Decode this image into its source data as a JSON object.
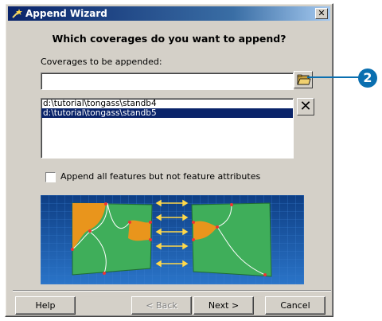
{
  "window": {
    "title": "Append Wizard",
    "close_glyph": "✕"
  },
  "question": "Which coverages do you want to append?",
  "coverages_label": "Coverages to be appended:",
  "coverage_input": {
    "value": ""
  },
  "browse_icon": "open-folder-icon",
  "delete_glyph": "✕",
  "list_items": [
    {
      "text": "d:\\tutorial\\tongass\\standb4",
      "selected": false
    },
    {
      "text": "d:\\tutorial\\tongass\\standb5",
      "selected": true
    }
  ],
  "append_checkbox": {
    "label": "Append all features but not feature attributes",
    "checked": false
  },
  "buttons": {
    "help": "Help",
    "back": "< Back",
    "next": "Next >",
    "cancel": "Cancel"
  },
  "callout": {
    "number": "2"
  },
  "colors": {
    "illustration_bg": "#1a5aa8",
    "polygon_green": "#3fae5a",
    "polygon_orange": "#e9951c",
    "callout": "#0a6fb0"
  }
}
